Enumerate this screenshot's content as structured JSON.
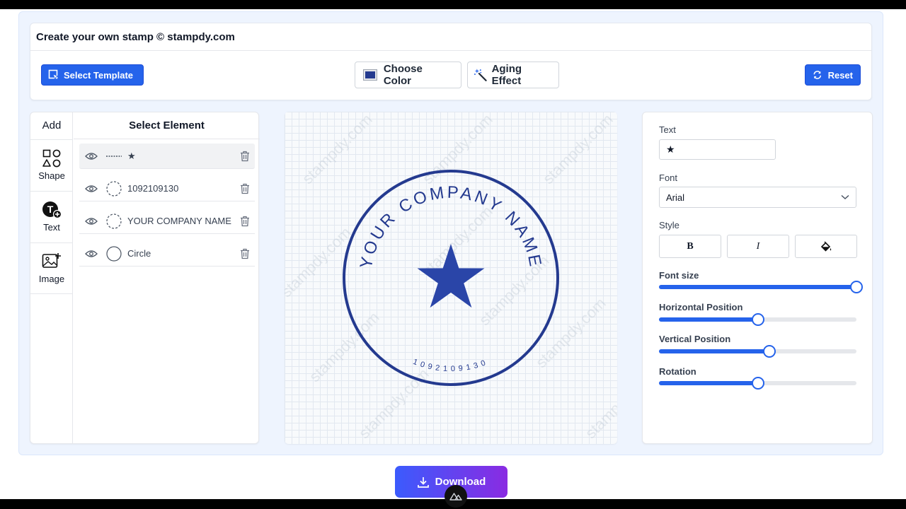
{
  "app": {
    "title": "Create your own stamp © stampdy.com"
  },
  "toolbar": {
    "select_template": "Select Template",
    "choose_color": "Choose Color",
    "aging_effect": "Aging Effect",
    "reset": "Reset",
    "stamp_color": "#243a8f"
  },
  "add_panel": {
    "heading": "Add",
    "items": [
      {
        "label": "Shape",
        "icon": "shapes-icon"
      },
      {
        "label": "Text",
        "icon": "add-text-icon"
      },
      {
        "label": "Image",
        "icon": "add-image-icon"
      }
    ]
  },
  "elements_panel": {
    "heading": "Select Element",
    "items": [
      {
        "label": "★",
        "thumb": "line"
      },
      {
        "label": "1092109130",
        "thumb": "dashed-circle"
      },
      {
        "label": "YOUR COMPANY NAME",
        "thumb": "dashed-circle"
      },
      {
        "label": "Circle",
        "thumb": "circle"
      }
    ]
  },
  "stamp": {
    "top_text": "YOUR COMPANY NAME",
    "bottom_text": "1092109130",
    "center_symbol": "★",
    "watermark": "stampdy.com"
  },
  "properties": {
    "text_label": "Text",
    "text_value": "★",
    "font_label": "Font",
    "font_value": "Arial",
    "style_label": "Style",
    "bold_label": "B",
    "italic_label": "I",
    "font_size_label": "Font size",
    "font_size_level": 1.0,
    "horizontal_label": "Horizontal Position",
    "horizontal_level": 0.5,
    "vertical_label": "Vertical Position",
    "vertical_level": 0.56,
    "rotation_label": "Rotation",
    "rotation_level": 0.5
  },
  "download": {
    "label": "Download"
  }
}
